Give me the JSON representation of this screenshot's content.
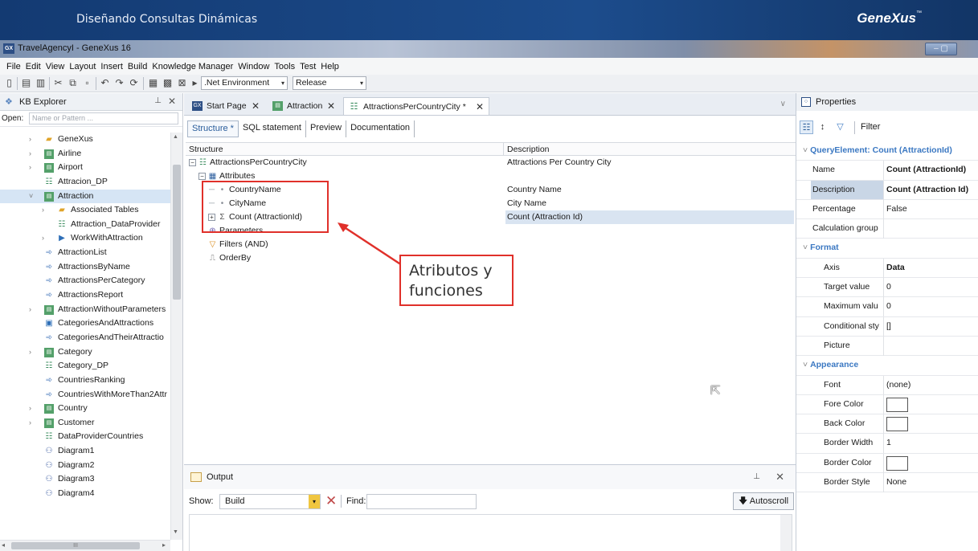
{
  "banner": {
    "title": "Diseñando Consultas Dinámicas",
    "brand": "GeneXus",
    "brand_tm": "™"
  },
  "window": {
    "title": "TravelAgencyI - GeneXus 16",
    "icon_text": "GX",
    "controls": "– ▢"
  },
  "menu": [
    "File",
    "Edit",
    "View",
    "Layout",
    "Insert",
    "Build",
    "Knowledge Manager",
    "Window",
    "Tools",
    "Test",
    "Help"
  ],
  "toolbar": {
    "environment": ".Net Environment",
    "configuration": "Release"
  },
  "kb_explorer": {
    "title": "KB Explorer",
    "open_label": "Open:",
    "open_placeholder": "Name or Pattern ...",
    "items": [
      {
        "label": "GeneXus",
        "icon": "folder-icon",
        "level": 1,
        "expander": "›"
      },
      {
        "label": "Airline",
        "icon": "transaction-icon",
        "level": 1,
        "expander": "›"
      },
      {
        "label": "Airport",
        "icon": "transaction-icon",
        "level": 1,
        "expander": "›"
      },
      {
        "label": "Attracion_DP",
        "icon": "data-provider-icon",
        "level": 1,
        "expander": ""
      },
      {
        "label": "Attraction",
        "icon": "transaction-icon",
        "level": 1,
        "expander": "˅",
        "selected": true
      },
      {
        "label": "Associated Tables",
        "icon": "folder-icon",
        "level": 2,
        "expander": "›"
      },
      {
        "label": "Attraction_DataProvider",
        "icon": "data-provider-icon",
        "level": 2,
        "expander": ""
      },
      {
        "label": "WorkWithAttraction",
        "icon": "work-with-icon",
        "level": 2,
        "expander": "›"
      },
      {
        "label": "AttractionList",
        "icon": "procedure-icon",
        "level": 1,
        "expander": ""
      },
      {
        "label": "AttractionsByName",
        "icon": "procedure-icon",
        "level": 1,
        "expander": ""
      },
      {
        "label": "AttractionsPerCategory",
        "icon": "procedure-icon",
        "level": 1,
        "expander": ""
      },
      {
        "label": "AttractionsReport",
        "icon": "procedure-icon",
        "level": 1,
        "expander": ""
      },
      {
        "label": "AttractionWithoutParameters",
        "icon": "transaction-icon",
        "level": 1,
        "expander": "›"
      },
      {
        "label": "CategoriesAndAttractions",
        "icon": "web-panel-icon",
        "level": 1,
        "expander": ""
      },
      {
        "label": "CategoriesAndTheirAttractio",
        "icon": "procedure-icon",
        "level": 1,
        "expander": ""
      },
      {
        "label": "Category",
        "icon": "transaction-icon",
        "level": 1,
        "expander": "›"
      },
      {
        "label": "Category_DP",
        "icon": "data-provider-icon",
        "level": 1,
        "expander": ""
      },
      {
        "label": "CountriesRanking",
        "icon": "procedure-icon",
        "level": 1,
        "expander": ""
      },
      {
        "label": "CountriesWithMoreThan2Attr",
        "icon": "procedure-icon",
        "level": 1,
        "expander": ""
      },
      {
        "label": "Country",
        "icon": "transaction-icon",
        "level": 1,
        "expander": "›"
      },
      {
        "label": "Customer",
        "icon": "transaction-icon",
        "level": 1,
        "expander": "›"
      },
      {
        "label": "DataProviderCountries",
        "icon": "data-provider-icon",
        "level": 1,
        "expander": ""
      },
      {
        "label": "Diagram1",
        "icon": "diagram-icon",
        "level": 1,
        "expander": ""
      },
      {
        "label": "Diagram2",
        "icon": "diagram-icon",
        "level": 1,
        "expander": ""
      },
      {
        "label": "Diagram3",
        "icon": "diagram-icon",
        "level": 1,
        "expander": ""
      },
      {
        "label": "Diagram4",
        "icon": "diagram-icon",
        "level": 1,
        "expander": ""
      }
    ],
    "hscroll_label": "III"
  },
  "doc_tabs": [
    {
      "label": "Start Page",
      "icon": "gx-icon",
      "active": false
    },
    {
      "label": "Attraction",
      "icon": "transaction-icon",
      "active": false
    },
    {
      "label": "AttractionsPerCountryCity *",
      "icon": "data-provider-icon",
      "active": true
    }
  ],
  "sub_tabs": [
    "Structure *",
    "SQL statement",
    "Preview",
    "Documentation"
  ],
  "structure_grid": {
    "headers": {
      "structure": "Structure",
      "description": "Description"
    },
    "rows": [
      {
        "name": "AttractionsPerCountryCity",
        "description": "Attractions Per Country City",
        "level": 0,
        "icon": "query-icon",
        "expander": "−"
      },
      {
        "name": "Attributes",
        "description": "",
        "level": 1,
        "icon": "attributes-icon",
        "expander": "−"
      },
      {
        "name": "CountryName",
        "description": "Country Name",
        "level": 2,
        "icon": "attribute-icon",
        "expander": ""
      },
      {
        "name": "CityName",
        "description": "City Name",
        "level": 2,
        "icon": "attribute-icon",
        "expander": ""
      },
      {
        "name": "Count (AttractionId)",
        "description": "Count (Attraction Id)",
        "level": 2,
        "icon": "function-icon",
        "expander": "+",
        "highlight": true
      },
      {
        "name": "Parameters",
        "description": "",
        "level": 1,
        "icon": "parameters-icon",
        "expander": ""
      },
      {
        "name": "Filters (AND)",
        "description": "",
        "level": 1,
        "icon": "filter-icon",
        "expander": ""
      },
      {
        "name": "OrderBy",
        "description": "",
        "level": 1,
        "icon": "orderby-icon",
        "expander": ""
      }
    ]
  },
  "annotation": {
    "line1": "Atributos y",
    "line2": "funciones",
    "color": "#e0302a"
  },
  "output": {
    "title": "Output",
    "show_label": "Show:",
    "show_value": "Build",
    "find_label": "Find:",
    "autoscroll_label": "Autoscroll"
  },
  "properties": {
    "title": "Properties",
    "filter_label": "Filter",
    "category": "QueryElement: Count (AttractionId)",
    "rows": [
      {
        "key": "Name",
        "value": "Count (AttractionId)",
        "bold": true
      },
      {
        "key": "Description",
        "value": "Count (Attraction Id)",
        "bold": true,
        "selected": true
      },
      {
        "key": "Percentage",
        "value": "False"
      },
      {
        "key": "Calculation group",
        "value": ""
      }
    ],
    "format_category": "Format",
    "format_rows": [
      {
        "key": "Axis",
        "value": "Data",
        "bold": true
      },
      {
        "key": "Target value",
        "value": "0"
      },
      {
        "key": "Maximum valu",
        "value": "0"
      },
      {
        "key": "Conditional sty",
        "value": "[]"
      },
      {
        "key": "Picture",
        "value": ""
      }
    ],
    "appearance_category": "Appearance",
    "appearance_rows": [
      {
        "key": "Font",
        "value": "(none)"
      },
      {
        "key": "Fore Color",
        "value": "",
        "swatch": true
      },
      {
        "key": "Back Color",
        "value": "",
        "swatch": true
      },
      {
        "key": "Border Width",
        "value": "1"
      },
      {
        "key": "Border Color",
        "value": "",
        "swatch": true
      },
      {
        "key": "Border Style",
        "value": "None"
      }
    ]
  },
  "colors": {
    "banner": "#1c4c8c",
    "accent": "#3b78c2",
    "selection": "#d6e5f5"
  }
}
